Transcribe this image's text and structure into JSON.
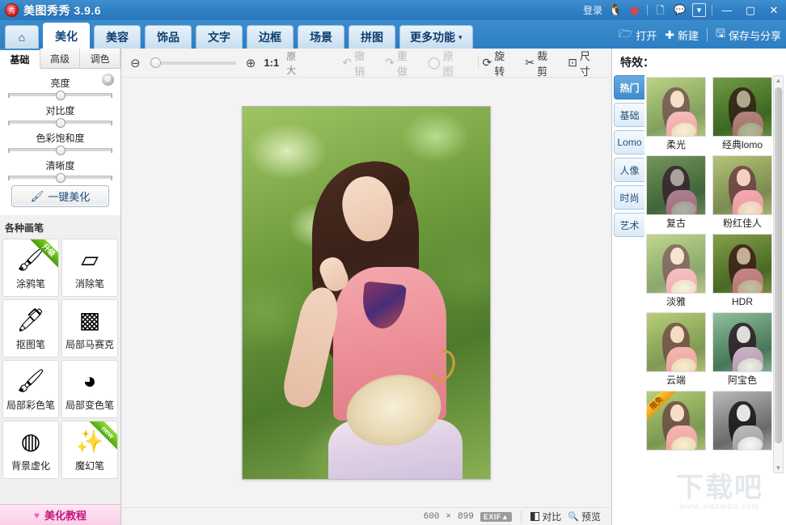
{
  "titlebar": {
    "app_title": "美图秀秀 3.9.6",
    "logo_text": "秀",
    "login_label": "登录",
    "icons": [
      {
        "name": "qq-icon",
        "glyph": "🐧"
      },
      {
        "name": "weibo-icon",
        "glyph": "◉"
      },
      {
        "name": "feedback-icon",
        "glyph": "🗋"
      },
      {
        "name": "message-icon",
        "glyph": "💬"
      },
      {
        "name": "dropdown-icon",
        "glyph": "▾"
      }
    ],
    "window_controls": {
      "minimize": "—",
      "maximize": "▢",
      "close": "✕"
    }
  },
  "menubar": {
    "home_icon": "⌂",
    "tabs": [
      {
        "label": "美化",
        "active": true
      },
      {
        "label": "美容",
        "active": false
      },
      {
        "label": "饰品",
        "active": false
      },
      {
        "label": "文字",
        "active": false
      },
      {
        "label": "边框",
        "active": false
      },
      {
        "label": "场景",
        "active": false
      },
      {
        "label": "拼图",
        "active": false
      },
      {
        "label": "更多功能",
        "active": false,
        "caret": "▾"
      }
    ],
    "actions": [
      {
        "name": "open-button",
        "icon": "🗁",
        "label": "打开"
      },
      {
        "name": "new-button",
        "icon": "✚",
        "label": "新建"
      },
      {
        "name": "save-share-button",
        "icon": "🖫",
        "label": "保存与分享"
      }
    ]
  },
  "left_panel": {
    "tabs": [
      {
        "label": "基础",
        "active": true
      },
      {
        "label": "高级",
        "active": false
      },
      {
        "label": "调色",
        "active": false
      }
    ],
    "reset_icon": "↺",
    "sliders": [
      {
        "label": "亮度",
        "value": 50
      },
      {
        "label": "对比度",
        "value": 50
      },
      {
        "label": "色彩饱和度",
        "value": 50
      },
      {
        "label": "清晰度",
        "value": 50
      }
    ],
    "onekey_button": {
      "label": "一键美化",
      "icon": "🖌"
    },
    "brush_section_title": "各种画笔",
    "brushes": [
      {
        "label": "涂鸦笔",
        "icon": "🖌",
        "ribbon": "升级",
        "ribbon_type": "green"
      },
      {
        "label": "消除笔",
        "icon": "▱",
        "ribbon": "",
        "ribbon_type": ""
      },
      {
        "label": "抠图笔",
        "icon": "🖊",
        "ribbon": "",
        "ribbon_type": ""
      },
      {
        "label": "局部马赛克",
        "icon": "▩",
        "ribbon": "",
        "ribbon_type": ""
      },
      {
        "label": "局部彩色笔",
        "icon": "🖌",
        "ribbon": "",
        "ribbon_type": ""
      },
      {
        "label": "局部变色笔",
        "icon": "◕",
        "ribbon": "",
        "ribbon_type": ""
      },
      {
        "label": "背景虚化",
        "icon": "◍",
        "ribbon": "",
        "ribbon_type": ""
      },
      {
        "label": "魔幻笔",
        "icon": "✨",
        "ribbon": "new",
        "ribbon_type": "new"
      }
    ],
    "tutorial": {
      "label": "美化教程",
      "icon": "♥"
    }
  },
  "toolbar": {
    "zoom_out_icon": "⊖",
    "zoom_in_icon": "⊕",
    "zoom_value": 0,
    "ratio_label": "1:1",
    "ratio_sub": "原大",
    "actions": [
      {
        "label": "撤销",
        "icon": "↶",
        "enabled": false
      },
      {
        "label": "重做",
        "icon": "↷",
        "enabled": false
      },
      {
        "label": "原图",
        "icon": "◯",
        "enabled": false
      },
      {
        "label": "旋转",
        "icon": "⟳",
        "enabled": true
      },
      {
        "label": "裁剪",
        "icon": "✂",
        "enabled": true
      },
      {
        "label": "尺寸",
        "icon": "⊡",
        "enabled": true
      }
    ]
  },
  "statusbar": {
    "width": "600",
    "times": "×",
    "height": "899",
    "exif_label": "EXIF▲",
    "compare_label": "对比",
    "preview_label": "预览",
    "preview_icon": "🔍"
  },
  "right_panel": {
    "title": "特效：",
    "side_tabs": [
      {
        "label": "热门",
        "active": true
      },
      {
        "label": "基础",
        "active": false
      },
      {
        "label": "Lomo",
        "active": false
      },
      {
        "label": "人像",
        "active": false
      },
      {
        "label": "时尚",
        "active": false
      },
      {
        "label": "艺术",
        "active": false
      }
    ],
    "effects": [
      {
        "label": "柔光",
        "tint": "rgba(255,245,220,0.30)",
        "ribbon": ""
      },
      {
        "label": "经典lomo",
        "tint": "rgba(20,60,20,0.30)",
        "ribbon": ""
      },
      {
        "label": "复古",
        "tint": "rgba(40,60,90,0.35)",
        "ribbon": ""
      },
      {
        "label": "粉红佳人",
        "tint": "rgba(255,190,200,0.25)",
        "ribbon": ""
      },
      {
        "label": "淡雅",
        "tint": "rgba(255,250,235,0.35)",
        "ribbon": ""
      },
      {
        "label": "HDR",
        "tint": "rgba(60,50,20,0.25)",
        "ribbon": ""
      },
      {
        "label": "云端",
        "tint": "rgba(255,235,190,0.28)",
        "ribbon": ""
      },
      {
        "label": "阿宝色",
        "tint": "rgba(30,140,220,0.45)",
        "ribbon": ""
      },
      {
        "label": "",
        "tint": "rgba(255,240,200,0.25)",
        "ribbon": "限免"
      },
      {
        "label": "",
        "tint": "grayscale",
        "ribbon": ""
      }
    ],
    "scrollbar": {
      "up": "▲",
      "down": "▼"
    }
  },
  "watermark": {
    "big": "下载吧",
    "small": "www.xiazaiba.com"
  },
  "colors": {
    "brand_blue": "#2f7fc4",
    "accent_blue": "#3f8bce",
    "tutorial_pink": "#c5177f"
  }
}
